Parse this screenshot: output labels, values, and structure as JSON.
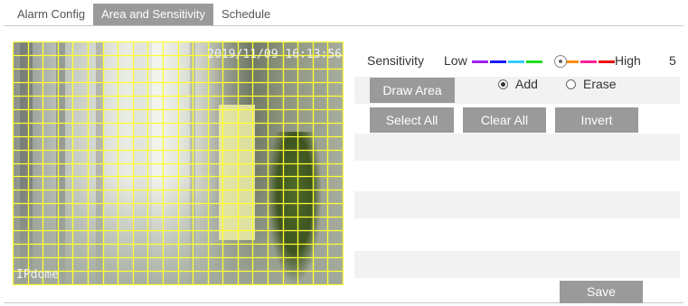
{
  "tabs": [
    {
      "label": "Alarm Config",
      "active": false
    },
    {
      "label": "Area and Sensitivity",
      "active": true
    },
    {
      "label": "Schedule",
      "active": false
    }
  ],
  "video": {
    "timestamp": "2019/11/09 16:13:56",
    "camera_label": "IPdome",
    "grid_color": "#ffff33",
    "grid_columns": 22,
    "grid_rows": 18
  },
  "sensitivity": {
    "label": "Sensitivity",
    "low_label": "Low",
    "high_label": "High",
    "value": "5",
    "scale_colors": [
      "#a020f0",
      "#1a1aff",
      "#33ccff",
      "#22dd22",
      "#ffffff",
      "#ff8800",
      "#ff2299",
      "#ee1111"
    ]
  },
  "controls": {
    "draw_area_label": "Draw Area",
    "add_label": "Add",
    "erase_label": "Erase",
    "draw_mode": "Add",
    "select_all_label": "Select All",
    "clear_all_label": "Clear All",
    "invert_label": "Invert",
    "save_label": "Save"
  },
  "colors": {
    "button_bg": "#9a9a9a",
    "row_shade": "#f2f2f2",
    "active_tab_bg": "#9a9a9a"
  }
}
